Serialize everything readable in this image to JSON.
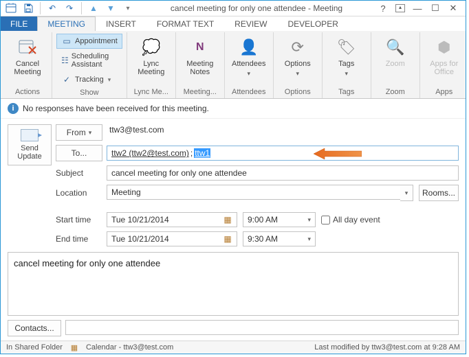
{
  "window": {
    "title": "cancel meeting for only one attendee - Meeting"
  },
  "ribbon_tabs": {
    "file": "FILE",
    "meeting": "MEETING",
    "insert": "INSERT",
    "format_text": "FORMAT TEXT",
    "review": "REVIEW",
    "developer": "DEVELOPER"
  },
  "ribbon": {
    "actions": {
      "label": "Actions",
      "cancel": "Cancel Meeting"
    },
    "show": {
      "label": "Show",
      "appointment": "Appointment",
      "scheduling": "Scheduling Assistant",
      "tracking": "Tracking"
    },
    "lync": {
      "label": "Lync Me...",
      "btn": "Lync Meeting"
    },
    "notes": {
      "label": "Meeting...",
      "btn": "Meeting Notes"
    },
    "attendees": {
      "label": "Attendees",
      "btn": "Attendees"
    },
    "options": {
      "label": "Options",
      "btn": "Options"
    },
    "tags": {
      "label": "Tags",
      "btn": "Tags"
    },
    "zoom": {
      "label": "Zoom",
      "btn": "Zoom"
    },
    "apps": {
      "label": "Apps",
      "btn": "Apps for Office"
    }
  },
  "info_bar": "No responses have been received for this meeting.",
  "form": {
    "send": "Send Update",
    "from_label": "From",
    "from_value": "ttw3@test.com",
    "to_label": "To...",
    "to_first": "ttw2 (ttw2@test.com)",
    "to_sep": "; ",
    "to_selected": "ttw1",
    "subject_label": "Subject",
    "subject_value": "cancel meeting for only one attendee",
    "location_label": "Location",
    "location_value": "Meeting",
    "rooms": "Rooms...",
    "start_label": "Start time",
    "end_label": "End time",
    "start_date": "Tue 10/21/2014",
    "start_time": "9:00 AM",
    "end_date": "Tue 10/21/2014",
    "end_time": "9:30 AM",
    "allday": "All day event"
  },
  "body_text": "cancel meeting for only one attendee",
  "contacts_btn": "Contacts...",
  "status": {
    "folder": "In Shared Folder",
    "calendar": "Calendar - ttw3@test.com",
    "modified": "Last modified by ttw3@test.com at 9:28 AM"
  }
}
